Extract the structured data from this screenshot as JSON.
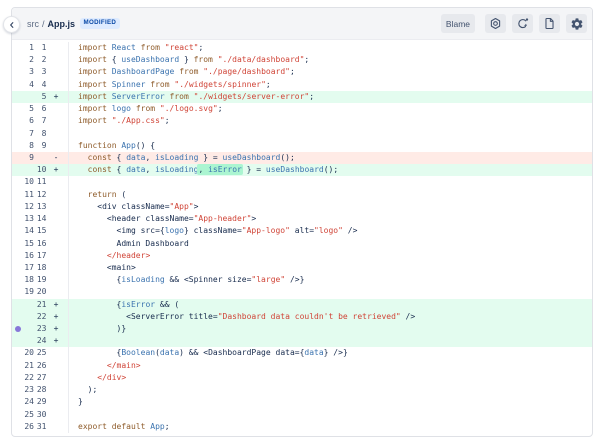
{
  "header": {
    "back_icon": "chevron-left-icon",
    "breadcrumb": {
      "dir": "src",
      "separator": "/",
      "file": "App.js"
    },
    "status_badge": "MODIFIED",
    "blame_button": "Blame",
    "icon_buttons": [
      "nut-icon",
      "refresh-icon",
      "document-icon",
      "gear-icon"
    ]
  },
  "colors": {
    "badge_bg": "#DEEBFF",
    "badge_text": "#0747A6",
    "added_bg": "#E3FCEF",
    "added_word_bg": "#ABF5D1",
    "removed_bg": "#FFEBE6",
    "keyword": "#8F5C2B",
    "identifier": "#3B73AF",
    "string": "#D04437",
    "plain": "#172B4D",
    "line_number": "#42526E",
    "comment_dot": "#8777D9"
  },
  "diff": {
    "lines": [
      {
        "old": "1",
        "new": "1",
        "type": "context",
        "marker": "",
        "segments": [
          {
            "c": "k",
            "t": "import"
          },
          {
            "c": "p",
            "t": " "
          },
          {
            "c": "i",
            "t": "React"
          },
          {
            "c": "p",
            "t": " "
          },
          {
            "c": "k",
            "t": "from"
          },
          {
            "c": "p",
            "t": " "
          },
          {
            "c": "s",
            "t": "\"react\""
          },
          {
            "c": "p",
            "t": ";"
          }
        ]
      },
      {
        "old": "2",
        "new": "2",
        "type": "context",
        "marker": "",
        "segments": [
          {
            "c": "k",
            "t": "import"
          },
          {
            "c": "p",
            "t": " { "
          },
          {
            "c": "i",
            "t": "useDashboard"
          },
          {
            "c": "p",
            "t": " } "
          },
          {
            "c": "k",
            "t": "from"
          },
          {
            "c": "p",
            "t": " "
          },
          {
            "c": "s",
            "t": "\"./data/dashboard\""
          },
          {
            "c": "p",
            "t": ";"
          }
        ]
      },
      {
        "old": "3",
        "new": "3",
        "type": "context",
        "marker": "",
        "segments": [
          {
            "c": "k",
            "t": "import"
          },
          {
            "c": "p",
            "t": " "
          },
          {
            "c": "i",
            "t": "DashboardPage"
          },
          {
            "c": "p",
            "t": " "
          },
          {
            "c": "k",
            "t": "from"
          },
          {
            "c": "p",
            "t": " "
          },
          {
            "c": "s",
            "t": "\"./page/dashboard\""
          },
          {
            "c": "p",
            "t": ";"
          }
        ]
      },
      {
        "old": "4",
        "new": "4",
        "type": "context",
        "marker": "",
        "segments": [
          {
            "c": "k",
            "t": "import"
          },
          {
            "c": "p",
            "t": " "
          },
          {
            "c": "i",
            "t": "Spinner"
          },
          {
            "c": "p",
            "t": " "
          },
          {
            "c": "k",
            "t": "from"
          },
          {
            "c": "p",
            "t": " "
          },
          {
            "c": "s",
            "t": "\"./widgets/spinner\""
          },
          {
            "c": "p",
            "t": ";"
          }
        ]
      },
      {
        "old": "",
        "new": "5",
        "type": "added",
        "marker": "+",
        "segments": [
          {
            "c": "k",
            "t": "import"
          },
          {
            "c": "p",
            "t": " "
          },
          {
            "c": "i",
            "t": "ServerError"
          },
          {
            "c": "p",
            "t": " "
          },
          {
            "c": "k",
            "t": "from"
          },
          {
            "c": "p",
            "t": " "
          },
          {
            "c": "s",
            "t": "\"./widgets/server-error\""
          },
          {
            "c": "p",
            "t": ";"
          }
        ]
      },
      {
        "old": "5",
        "new": "6",
        "type": "context",
        "marker": "",
        "segments": [
          {
            "c": "k",
            "t": "import"
          },
          {
            "c": "p",
            "t": " "
          },
          {
            "c": "i",
            "t": "logo"
          },
          {
            "c": "p",
            "t": " "
          },
          {
            "c": "k",
            "t": "from"
          },
          {
            "c": "p",
            "t": " "
          },
          {
            "c": "s",
            "t": "\"./logo.svg\""
          },
          {
            "c": "p",
            "t": ";"
          }
        ]
      },
      {
        "old": "6",
        "new": "7",
        "type": "context",
        "marker": "",
        "segments": [
          {
            "c": "k",
            "t": "import"
          },
          {
            "c": "p",
            "t": " "
          },
          {
            "c": "s",
            "t": "\"./App.css\""
          },
          {
            "c": "p",
            "t": ";"
          }
        ]
      },
      {
        "old": "7",
        "new": "8",
        "type": "context",
        "marker": "",
        "segments": []
      },
      {
        "old": "8",
        "new": "9",
        "type": "context",
        "marker": "",
        "segments": [
          {
            "c": "k",
            "t": "function"
          },
          {
            "c": "p",
            "t": " "
          },
          {
            "c": "i",
            "t": "App"
          },
          {
            "c": "p",
            "t": "() {"
          }
        ]
      },
      {
        "old": "9",
        "new": "",
        "type": "removed",
        "marker": "-",
        "segments": [
          {
            "c": "p",
            "t": "  "
          },
          {
            "c": "k",
            "t": "const"
          },
          {
            "c": "p",
            "t": " { "
          },
          {
            "c": "i",
            "t": "data"
          },
          {
            "c": "p",
            "t": ", "
          },
          {
            "c": "i",
            "t": "isLoading"
          },
          {
            "c": "p",
            "t": " } = "
          },
          {
            "c": "i",
            "t": "useDashboard"
          },
          {
            "c": "p",
            "t": "();"
          }
        ]
      },
      {
        "old": "",
        "new": "10",
        "type": "added",
        "marker": "+",
        "segments": [
          {
            "c": "p",
            "t": "  "
          },
          {
            "c": "k",
            "t": "const"
          },
          {
            "c": "p",
            "t": " { "
          },
          {
            "c": "i",
            "t": "data"
          },
          {
            "c": "p",
            "t": ", "
          },
          {
            "c": "i",
            "t": "isLoading"
          },
          {
            "c": "p",
            "t": ",",
            "h": true
          },
          {
            "c": "p",
            "t": " ",
            "h": true
          },
          {
            "c": "i",
            "t": "isError",
            "h": true
          },
          {
            "c": "p",
            "t": " } = "
          },
          {
            "c": "i",
            "t": "useDashboard"
          },
          {
            "c": "p",
            "t": "();"
          }
        ]
      },
      {
        "old": "10",
        "new": "11",
        "type": "context",
        "marker": "",
        "segments": []
      },
      {
        "old": "11",
        "new": "12",
        "type": "context",
        "marker": "",
        "segments": [
          {
            "c": "p",
            "t": "  "
          },
          {
            "c": "k",
            "t": "return"
          },
          {
            "c": "p",
            "t": " ("
          }
        ]
      },
      {
        "old": "12",
        "new": "13",
        "type": "context",
        "marker": "",
        "segments": [
          {
            "c": "p",
            "t": "    <div className="
          },
          {
            "c": "s",
            "t": "\"App\""
          },
          {
            "c": "p",
            "t": ">"
          }
        ]
      },
      {
        "old": "13",
        "new": "14",
        "type": "context",
        "marker": "",
        "segments": [
          {
            "c": "p",
            "t": "      <header className="
          },
          {
            "c": "s",
            "t": "\"App-header\""
          },
          {
            "c": "p",
            "t": ">"
          }
        ]
      },
      {
        "old": "14",
        "new": "15",
        "type": "context",
        "marker": "",
        "segments": [
          {
            "c": "p",
            "t": "        <img src={"
          },
          {
            "c": "i",
            "t": "logo"
          },
          {
            "c": "p",
            "t": "} className="
          },
          {
            "c": "s",
            "t": "\"App-logo\""
          },
          {
            "c": "p",
            "t": " alt="
          },
          {
            "c": "s",
            "t": "\"logo\""
          },
          {
            "c": "p",
            "t": " />"
          }
        ]
      },
      {
        "old": "15",
        "new": "16",
        "type": "context",
        "marker": "",
        "segments": [
          {
            "c": "p",
            "t": "        Admin Dashboard"
          }
        ]
      },
      {
        "old": "16",
        "new": "17",
        "type": "context",
        "marker": "",
        "segments": [
          {
            "c": "p",
            "t": "      "
          },
          {
            "c": "t",
            "t": "</header>"
          }
        ]
      },
      {
        "old": "17",
        "new": "18",
        "type": "context",
        "marker": "",
        "segments": [
          {
            "c": "p",
            "t": "      <main>"
          }
        ]
      },
      {
        "old": "18",
        "new": "19",
        "type": "context",
        "marker": "",
        "segments": [
          {
            "c": "p",
            "t": "        {"
          },
          {
            "c": "i",
            "t": "isLoading"
          },
          {
            "c": "p",
            "t": " && <Spinner size="
          },
          {
            "c": "s",
            "t": "\"large\""
          },
          {
            "c": "p",
            "t": " />}"
          }
        ]
      },
      {
        "old": "19",
        "new": "20",
        "type": "context",
        "marker": "",
        "segments": []
      },
      {
        "old": "",
        "new": "21",
        "type": "added",
        "marker": "+",
        "segments": [
          {
            "c": "p",
            "t": "        {"
          },
          {
            "c": "i",
            "t": "isError"
          },
          {
            "c": "p",
            "t": " && ("
          }
        ]
      },
      {
        "old": "",
        "new": "22",
        "type": "added",
        "marker": "+",
        "segments": [
          {
            "c": "p",
            "t": "          <ServerError title="
          },
          {
            "c": "s",
            "t": "\"Dashboard data couldn't be retrieved\""
          },
          {
            "c": "p",
            "t": " />"
          }
        ]
      },
      {
        "old": "",
        "new": "23",
        "type": "added",
        "marker": "+",
        "dot": true,
        "segments": [
          {
            "c": "p",
            "t": "        )}"
          }
        ]
      },
      {
        "old": "",
        "new": "24",
        "type": "added",
        "marker": "+",
        "segments": []
      },
      {
        "old": "20",
        "new": "25",
        "type": "context",
        "marker": "",
        "segments": [
          {
            "c": "p",
            "t": "        {"
          },
          {
            "c": "i",
            "t": "Boolean"
          },
          {
            "c": "p",
            "t": "("
          },
          {
            "c": "i",
            "t": "data"
          },
          {
            "c": "p",
            "t": ") && <DashboardPage data={"
          },
          {
            "c": "i",
            "t": "data"
          },
          {
            "c": "p",
            "t": "} />}"
          }
        ]
      },
      {
        "old": "21",
        "new": "26",
        "type": "context",
        "marker": "",
        "segments": [
          {
            "c": "p",
            "t": "      "
          },
          {
            "c": "t",
            "t": "</main>"
          }
        ]
      },
      {
        "old": "22",
        "new": "27",
        "type": "context",
        "marker": "",
        "segments": [
          {
            "c": "p",
            "t": "    "
          },
          {
            "c": "t",
            "t": "</div>"
          }
        ]
      },
      {
        "old": "23",
        "new": "28",
        "type": "context",
        "marker": "",
        "segments": [
          {
            "c": "p",
            "t": "  );"
          }
        ]
      },
      {
        "old": "24",
        "new": "29",
        "type": "context",
        "marker": "",
        "segments": [
          {
            "c": "p",
            "t": "}"
          }
        ]
      },
      {
        "old": "25",
        "new": "30",
        "type": "context",
        "marker": "",
        "segments": []
      },
      {
        "old": "26",
        "new": "31",
        "type": "context",
        "marker": "",
        "segments": [
          {
            "c": "k",
            "t": "export"
          },
          {
            "c": "p",
            "t": " "
          },
          {
            "c": "k",
            "t": "default"
          },
          {
            "c": "p",
            "t": " "
          },
          {
            "c": "i",
            "t": "App"
          },
          {
            "c": "p",
            "t": ";"
          }
        ]
      }
    ]
  }
}
